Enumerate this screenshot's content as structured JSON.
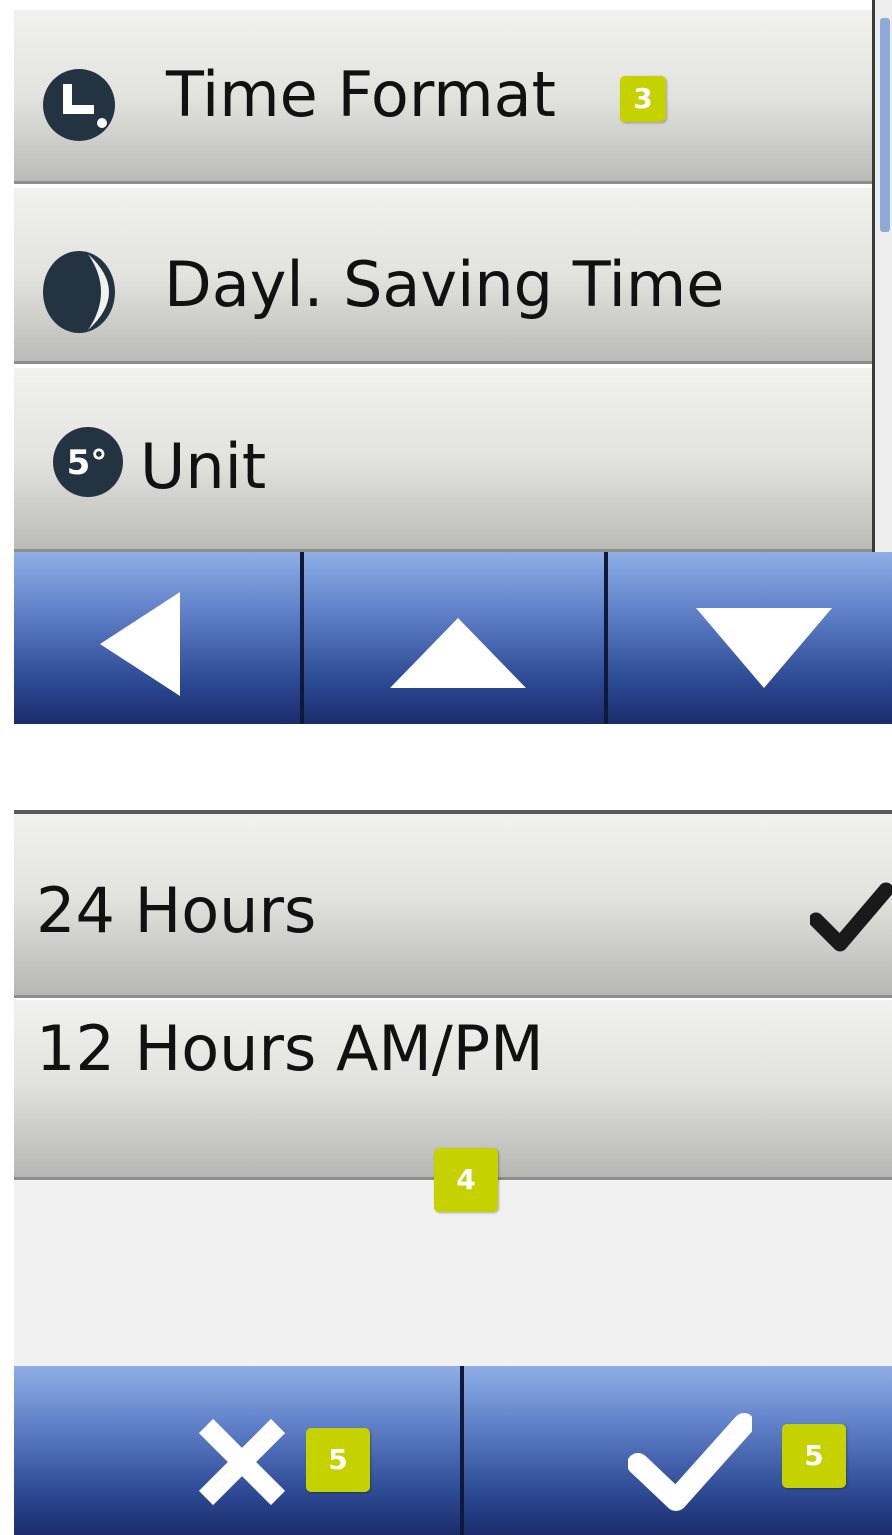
{
  "settings_menu": {
    "items": [
      {
        "label": "Time Format",
        "icon": "clock-icon",
        "badge": "3"
      },
      {
        "label": "Dayl. Saving Time",
        "icon": "moon-icon"
      },
      {
        "label": "Unit",
        "icon": "temperature-unit-icon",
        "icon_text": "5°"
      }
    ],
    "nav_buttons": [
      {
        "icon": "arrow-left-icon"
      },
      {
        "icon": "arrow-up-icon"
      },
      {
        "icon": "arrow-down-icon"
      }
    ]
  },
  "time_format_dialog": {
    "options": [
      {
        "label": "24 Hours",
        "selected": true
      },
      {
        "label": "12 Hours AM/PM",
        "selected": false
      }
    ],
    "options_badge": "4",
    "actions": [
      {
        "icon": "cancel-x-icon",
        "badge": "5"
      },
      {
        "icon": "confirm-check-icon",
        "badge": "5"
      }
    ]
  },
  "colors": {
    "badge": "#c5d200",
    "nav_blue": "#2d4a94",
    "menu_grey": "#e2e2df"
  }
}
